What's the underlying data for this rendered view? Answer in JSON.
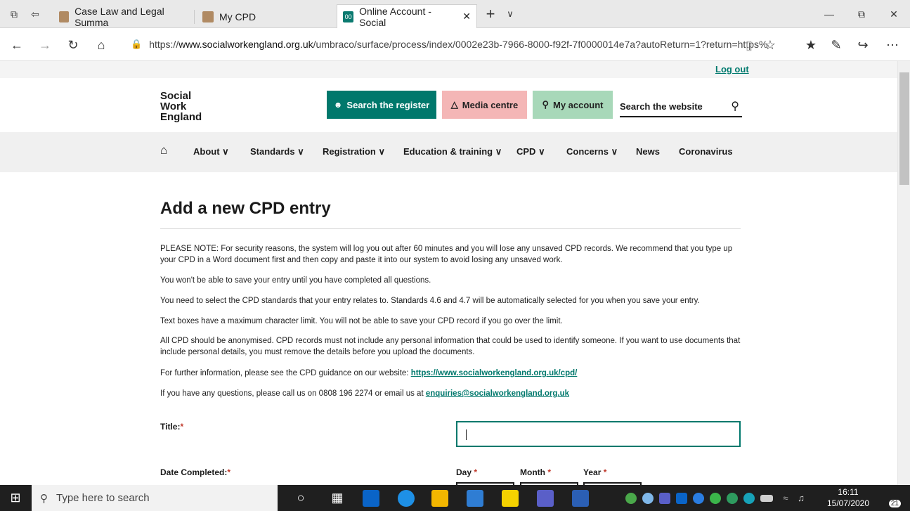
{
  "browser": {
    "tabs": [
      {
        "label": "Case Law and Legal Summa",
        "favicon_color": "#b08a63"
      },
      {
        "label": "My CPD",
        "favicon_color": "#b08a63"
      },
      {
        "label": "Online Account - Social",
        "favicon_color": "#0b7a70",
        "favicon_text": "00"
      }
    ],
    "new_tab_label": "+",
    "tab_list_label": "∨",
    "url_prefix": "https://",
    "url_host": "www.socialworkengland.org.uk",
    "url_path": "/umbraco/surface/process/index/0002e23b-7966-8000-f92f-7f0000014e7a?autoReturn=1?return=https%",
    "window_controls": {
      "minimize": "—",
      "restore": "⧉",
      "close": "✕"
    },
    "nav": {
      "back": "←",
      "forward": "→",
      "refresh": "↻",
      "home": "⌂"
    },
    "toolbar": {
      "reading_view": "▯",
      "favorite": "☆",
      "favorites_list": "★",
      "notes": "✎",
      "share": "↪",
      "more": "⋯"
    }
  },
  "site": {
    "logout_label": "Log out",
    "logo_lines": [
      "Social",
      "Work",
      "England"
    ],
    "header_buttons": {
      "search_register": "Search the register",
      "media_centre": "Media centre",
      "my_account": "My account"
    },
    "search_placeholder": "Search the website",
    "nav_items": [
      "About",
      "Standards",
      "Registration",
      "Education & training",
      "CPD",
      "Concerns",
      "News",
      "Coronavirus"
    ],
    "nav_dropdown_marker": "∨"
  },
  "content": {
    "heading": "Add a new CPD entry",
    "para1": "PLEASE NOTE: For security reasons, the system will log you out after 60 minutes and you will lose any unsaved CPD records. We recommend that you type up your CPD in a Word document first and then copy and paste it into our system to avoid losing any unsaved work.",
    "para2": "You won't be able to save your entry until you have completed all questions.",
    "para3": "You need to select the CPD standards that your entry relates to. Standards 4.6 and 4.7 will be automatically selected for you when you save your entry.",
    "para4": "Text boxes have a maximum character limit. You will not be able to save your CPD record if you go over the limit.",
    "para5": "All CPD should be anonymised. CPD records must not include any personal information that could be used to identify someone. If you want to use documents that include personal details, you must remove the details before you upload the documents.",
    "para6_text": "For further information, please see the CPD guidance on our website: ",
    "para6_link": "https://www.socialworkengland.org.uk/cpd/",
    "para7_text": "If you have any questions, please call us on 0808 196 2274 or email us at ",
    "para7_link": "enquiries@socialworkengland.org.uk",
    "form": {
      "title_label": "Title:",
      "date_label": "Date Completed:",
      "day_label": "Day",
      "month_label": "Month",
      "year_label": "Year",
      "required_marker": "*"
    }
  },
  "taskbar": {
    "search_placeholder": "Type here to search",
    "time": "16:11",
    "date": "15/07/2020",
    "notification_count": "21"
  }
}
